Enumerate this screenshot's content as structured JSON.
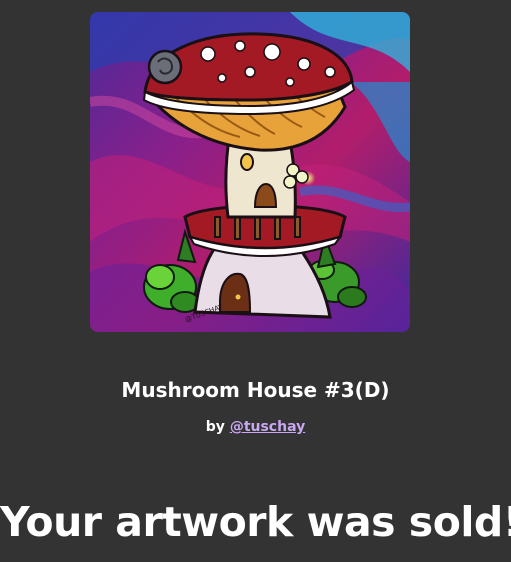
{
  "artwork": {
    "title": "Mushroom House #3(D)",
    "by_label": "by",
    "artist_handle": "@tuschay",
    "signature_text": "@TUSCHAY"
  },
  "message": {
    "headline": "Your artwork was sold!"
  },
  "colors": {
    "page_background": "#333333",
    "text": "#ffffff",
    "link": "#c9a7f2",
    "mushroom_cap_red": "#a31a24",
    "mushroom_gills_orange": "#e7a33a",
    "stem_cream": "#efe6d0"
  }
}
